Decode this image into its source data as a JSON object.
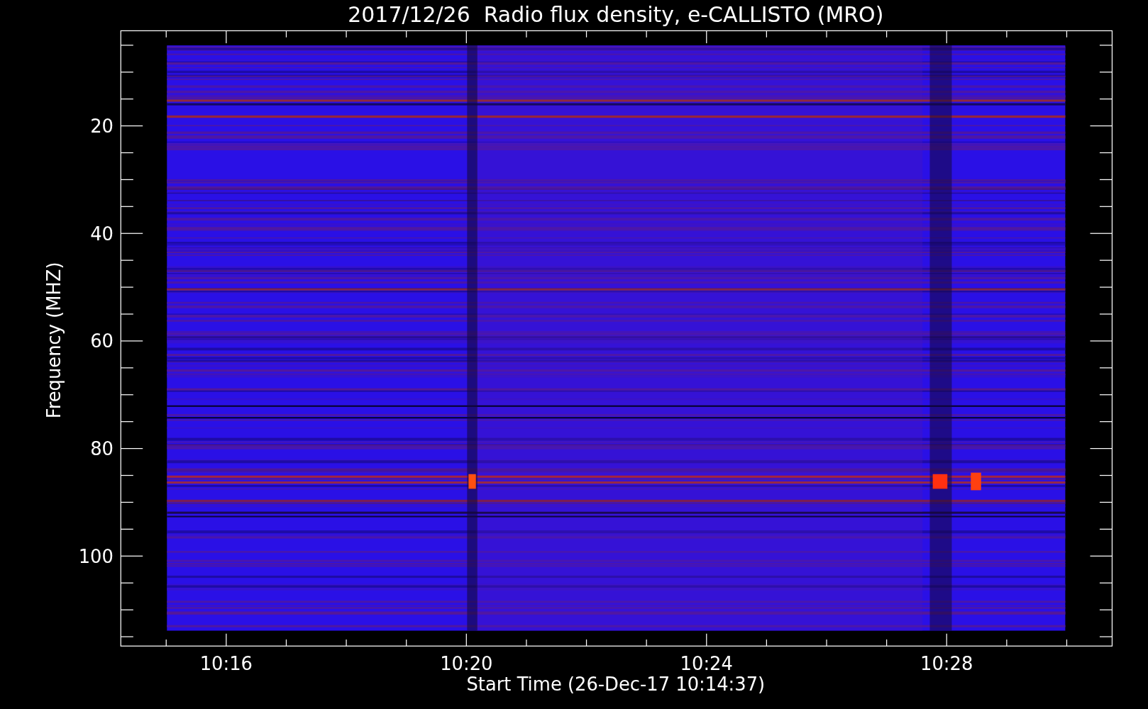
{
  "plot": {
    "title": "2017/12/26  Radio flux density, e-CALLISTO (MRO)",
    "xlabel": "Start Time (26-Dec-17 10:14:37)",
    "ylabel": "Frequency (MHZ)",
    "x_tick_labels": [
      "10:16",
      "10:20",
      "10:24",
      "10:28"
    ],
    "y_tick_labels": [
      "20",
      "40",
      "60",
      "80",
      "100"
    ]
  }
}
